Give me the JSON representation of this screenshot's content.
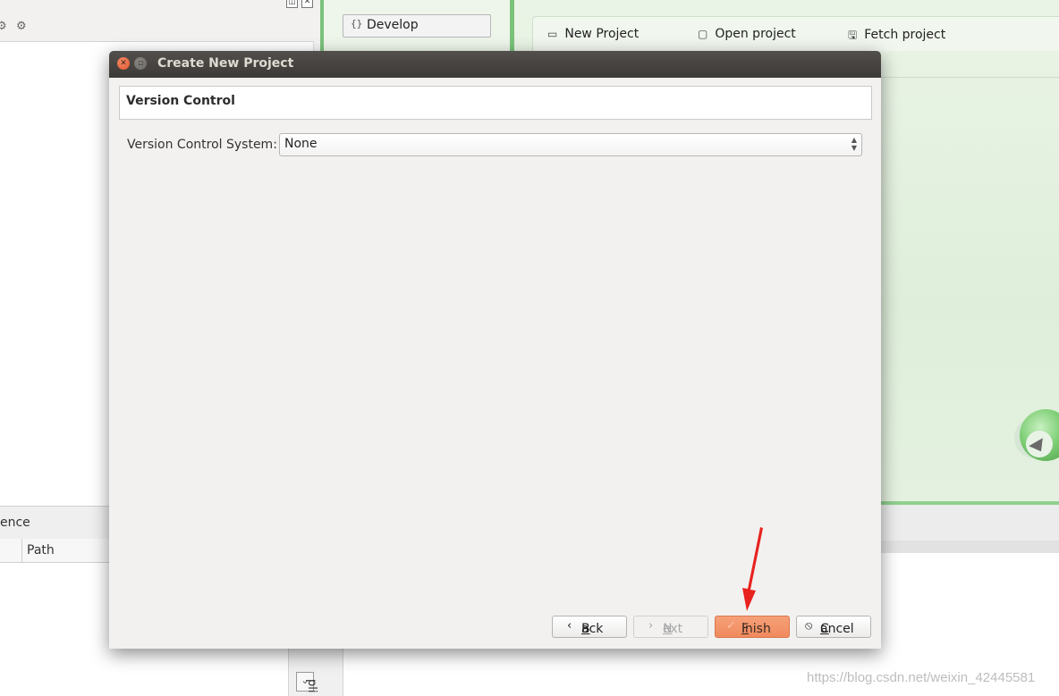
{
  "background": {
    "left_panel": {
      "column_header_partial": "ence",
      "path_column": "Path"
    },
    "mode_selector": {
      "develop_label": "Develop"
    },
    "welcome_bar": {
      "new_project": "New Project",
      "open_project": "Open project",
      "fetch_project": "Fetch project"
    },
    "bottom_panel_label": "pli"
  },
  "dialog": {
    "title": "Create New Project",
    "section_title": "Version Control",
    "vcs_label": "Version Control System:",
    "vcs_value": "None",
    "buttons": {
      "back_prefix": "",
      "back_mnemonic": "B",
      "back_rest": "ack",
      "next_mnemonic": "N",
      "next_rest": "ext",
      "finish_mnemonic": "F",
      "finish_rest": "inish",
      "cancel_mnemonic": "C",
      "cancel_rest": "ancel"
    }
  },
  "watermark": "https://blog.csdn.net/weixin_42445581",
  "colors": {
    "accent_finish": "#f08a5d",
    "annotation_arrow": "#e8231f",
    "qt_green": "#7bc27b"
  }
}
